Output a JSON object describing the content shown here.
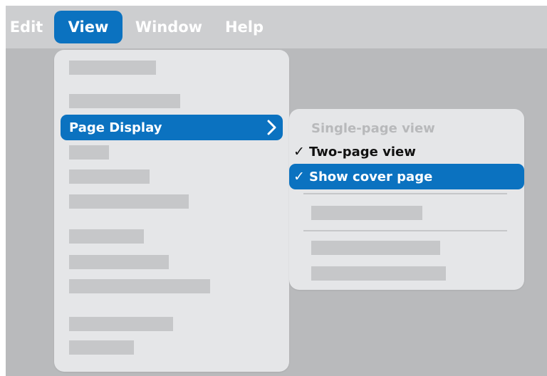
{
  "menubar": {
    "items": [
      {
        "label": "Edit",
        "active": false
      },
      {
        "label": "View",
        "active": true
      },
      {
        "label": "Window",
        "active": false
      },
      {
        "label": "Help",
        "active": false
      }
    ]
  },
  "view_menu": {
    "highlighted_item": "Page Display"
  },
  "page_display_submenu": {
    "items": [
      {
        "label": "Single-page view",
        "enabled": false,
        "checked": false
      },
      {
        "label": "Two-page view",
        "enabled": true,
        "checked": true
      },
      {
        "label": "Show cover page",
        "enabled": true,
        "checked": true,
        "highlighted": true
      }
    ],
    "check_glyph": "✓"
  },
  "colors": {
    "accent": "#0b72c0",
    "menubar": "#cdced0",
    "background": "#b9babc",
    "menu": "#e5e6e8",
    "placeholder": "#c6c7c9",
    "disabled_text": "#b8b9bb"
  },
  "icons": {
    "submenu_arrow": "chevron-right-icon",
    "check": "checkmark-icon"
  }
}
